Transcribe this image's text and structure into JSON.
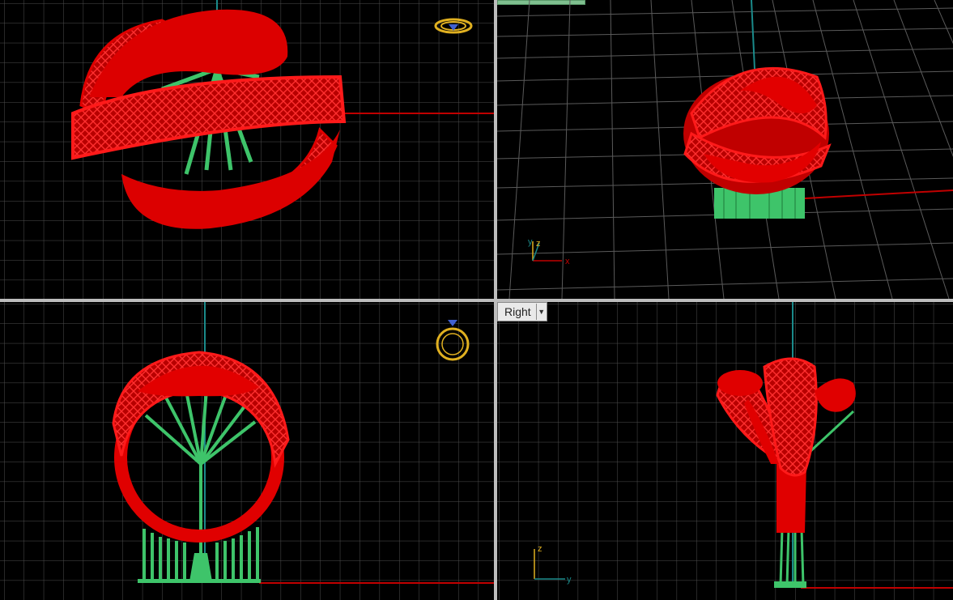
{
  "viewports": {
    "top": {
      "label": ""
    },
    "perspective": {
      "label": ""
    },
    "front": {
      "label": ""
    },
    "right": {
      "label": "Right",
      "dropdown_icon": "chevron-down-icon"
    }
  },
  "axes": {
    "x": "x",
    "y": "y",
    "z": "z"
  },
  "colors": {
    "background": "#000000",
    "grid": "#5a5a5a",
    "grid_major": "#8a8a8a",
    "x_axis": "#c00000",
    "y_axis": "#1a8a8a",
    "model": "#e00000",
    "supports": "#3ec46a",
    "view_widget": "#e0b020"
  },
  "icons": [
    "ring-top-view-icon",
    "ring-front-view-icon",
    "chevron-down-icon"
  ]
}
